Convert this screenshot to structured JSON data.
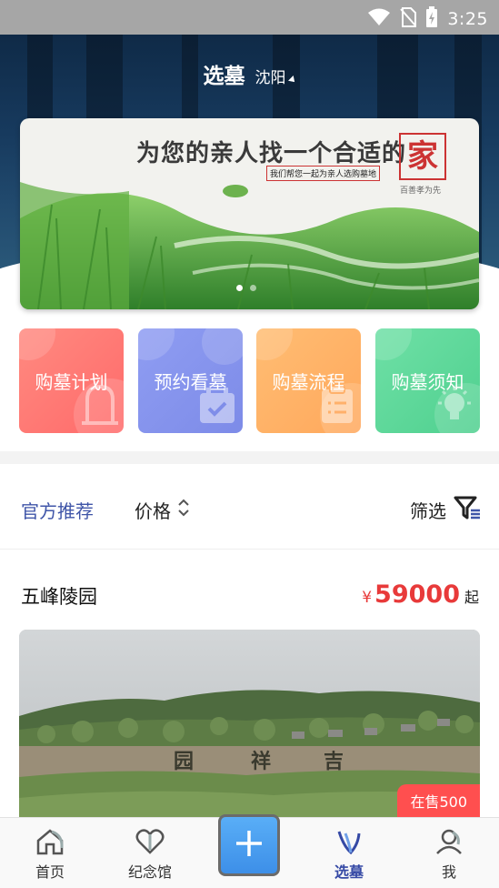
{
  "status_bar": {
    "time": "3:25",
    "icons": [
      "wifi-icon",
      "no-sim-icon",
      "battery-charging-icon"
    ]
  },
  "header": {
    "title": "选墓",
    "city": "沈阳"
  },
  "banner": {
    "headline": "为您的亲人找一个合适的",
    "seal_char": "家",
    "subtitle": "我们帮您一起为亲人选购墓地",
    "tagline": "百善孝为先",
    "active_dot": 0,
    "dot_count": 2
  },
  "quick_actions": [
    {
      "label": "购墓计划",
      "icon": "tombstone-icon",
      "color_from": "#ff8a80",
      "color_to": "#ff6a6a"
    },
    {
      "label": "预约看墓",
      "icon": "calendar-check-icon",
      "color_from": "#8f9df2",
      "color_to": "#7d8be8"
    },
    {
      "label": "购墓流程",
      "icon": "clipboard-list-icon",
      "color_from": "#ffbd73",
      "color_to": "#ffa85c"
    },
    {
      "label": "购墓须知",
      "icon": "lightbulb-icon",
      "color_from": "#6fe0a6",
      "color_to": "#4fd08f"
    }
  ],
  "filters": {
    "official": "官方推荐",
    "price": "价格",
    "screen": "筛选"
  },
  "listing": {
    "name": "五峰陵园",
    "currency": "¥",
    "price": "59000",
    "price_suffix": "起",
    "on_sale": "在售500"
  },
  "tabbar": {
    "items": [
      {
        "label": "首页",
        "icon": "home-icon"
      },
      {
        "label": "纪念馆",
        "icon": "heart-icon"
      },
      {
        "label": "",
        "icon": "plus-icon"
      },
      {
        "label": "选墓",
        "icon": "select-grave-icon",
        "active": true
      },
      {
        "label": "我",
        "icon": "user-icon"
      }
    ]
  },
  "colors": {
    "accent": "#3f55a8",
    "price": "#e83a3a",
    "on_sale": "#ff4f4f"
  }
}
